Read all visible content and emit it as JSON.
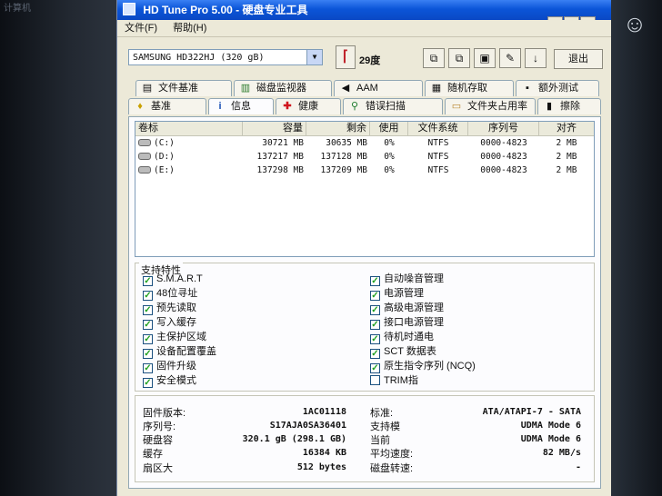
{
  "window": {
    "title": "HD Tune Pro 5.00 - 硬盘专业工具"
  },
  "menu": {
    "file": "文件(F)",
    "help": "帮助(H)"
  },
  "window_controls": {
    "minimize": "_",
    "maximize": "□",
    "close": "x"
  },
  "toolbar": {
    "drive": "SAMSUNG HD322HJ (320 gB)",
    "temperature": "29度",
    "exit_label": "退出"
  },
  "tabs_top": [
    {
      "label": "文件基准",
      "icon": "document-icon"
    },
    {
      "label": "磁盘监视器",
      "icon": "bar-chart-icon"
    },
    {
      "label": "AAM",
      "icon": "speaker-icon"
    },
    {
      "label": "随机存取",
      "icon": "grid-icon"
    },
    {
      "label": "额外测试",
      "icon": "extra-test-icon"
    }
  ],
  "tabs_bottom": [
    {
      "label": "基准",
      "icon": "benchmark-icon"
    },
    {
      "label": "信息",
      "icon": "info-icon",
      "active": true
    },
    {
      "label": "健康",
      "icon": "health-cross-icon"
    },
    {
      "label": "错误扫描",
      "icon": "magnifier-icon"
    },
    {
      "label": "文件夹占用率",
      "icon": "folder-icon"
    },
    {
      "label": "擦除",
      "icon": "trash-icon"
    }
  ],
  "volumes": {
    "headers": [
      "卷标",
      "容量",
      "剩余",
      "使用",
      "文件系统",
      "序列号",
      "对齐"
    ],
    "rows": [
      {
        "label": "(C:)",
        "capacity": "30721 MB",
        "free": "30635 MB",
        "used": "0%",
        "fs": "NTFS",
        "serial": "0000-4823",
        "align": "2 MB"
      },
      {
        "label": "(D:)",
        "capacity": "137217 MB",
        "free": "137128 MB",
        "used": "0%",
        "fs": "NTFS",
        "serial": "0000-4823",
        "align": "2 MB"
      },
      {
        "label": "(E:)",
        "capacity": "137298 MB",
        "free": "137209 MB",
        "used": "0%",
        "fs": "NTFS",
        "serial": "0000-4823",
        "align": "2 MB"
      }
    ]
  },
  "features": {
    "title": "支持特性",
    "left": [
      {
        "label": "S.M.A.R.T",
        "checked": true
      },
      {
        "label": "48位寻址",
        "checked": true
      },
      {
        "label": "预先读取",
        "checked": true
      },
      {
        "label": "写入缓存",
        "checked": true
      },
      {
        "label": "主保护区域",
        "checked": true
      },
      {
        "label": "设备配置覆盖",
        "checked": true
      },
      {
        "label": "固件升级",
        "checked": true
      },
      {
        "label": "安全模式",
        "checked": true
      }
    ],
    "right": [
      {
        "label": "自动噪音管理",
        "checked": true
      },
      {
        "label": "电源管理",
        "checked": true
      },
      {
        "label": "高级电源管理",
        "checked": true
      },
      {
        "label": "接口电源管理",
        "checked": true
      },
      {
        "label": "待机时通电",
        "checked": true
      },
      {
        "label": "SCT 数据表",
        "checked": true
      },
      {
        "label": "原生指令序列 (NCQ)",
        "checked": true
      },
      {
        "label": "TRIM指",
        "checked": false
      }
    ]
  },
  "info": {
    "left": [
      {
        "label": "固件版本:",
        "value": "1AC01118"
      },
      {
        "label": "序列号:",
        "value": "S17AJA0SA36401"
      },
      {
        "label": "硬盘容",
        "value": "320.1 gB (298.1 GB)"
      },
      {
        "label": "缓存",
        "value": "16384 KB"
      },
      {
        "label": "扇区大",
        "value": "512 bytes"
      }
    ],
    "right": [
      {
        "label": "标准:",
        "value": "ATA/ATAPI-7 - SATA"
      },
      {
        "label": "支持模",
        "value": "UDMA Mode 6"
      },
      {
        "label": "当前",
        "value": "UDMA Mode 6"
      },
      {
        "label": "平均速度:",
        "value": "82 MB/s"
      },
      {
        "label": "磁盘转速:",
        "value": "-"
      }
    ]
  },
  "desktop": {
    "edge_text": "计算机",
    "logo_glyph": "☺"
  }
}
